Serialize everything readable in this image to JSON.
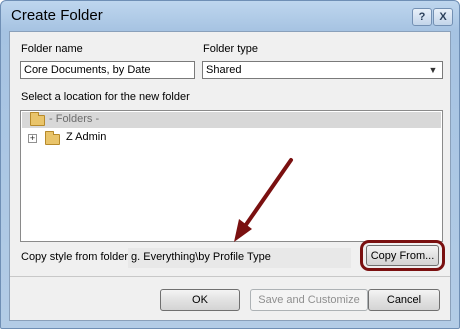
{
  "window": {
    "title": "Create Folder",
    "help_glyph": "?",
    "close_glyph": "X"
  },
  "form": {
    "folder_name_label": "Folder name",
    "folder_name_value": "Core Documents, by Date",
    "folder_type_label": "Folder type",
    "folder_type_value": "Shared",
    "location_label": "Select a location for the new folder",
    "tree": {
      "root_label": "- Folders -",
      "items": [
        {
          "label": "Z Admin",
          "expander": "+"
        }
      ]
    },
    "copy_style_label": "Copy style from folder",
    "copy_style_value": "g. Everything\\by Profile Type",
    "copy_from_label": "Copy From..."
  },
  "buttons": {
    "ok": "OK",
    "save_customize": "Save and Customize",
    "cancel": "Cancel"
  },
  "annotation": {
    "color": "#7a1010"
  }
}
